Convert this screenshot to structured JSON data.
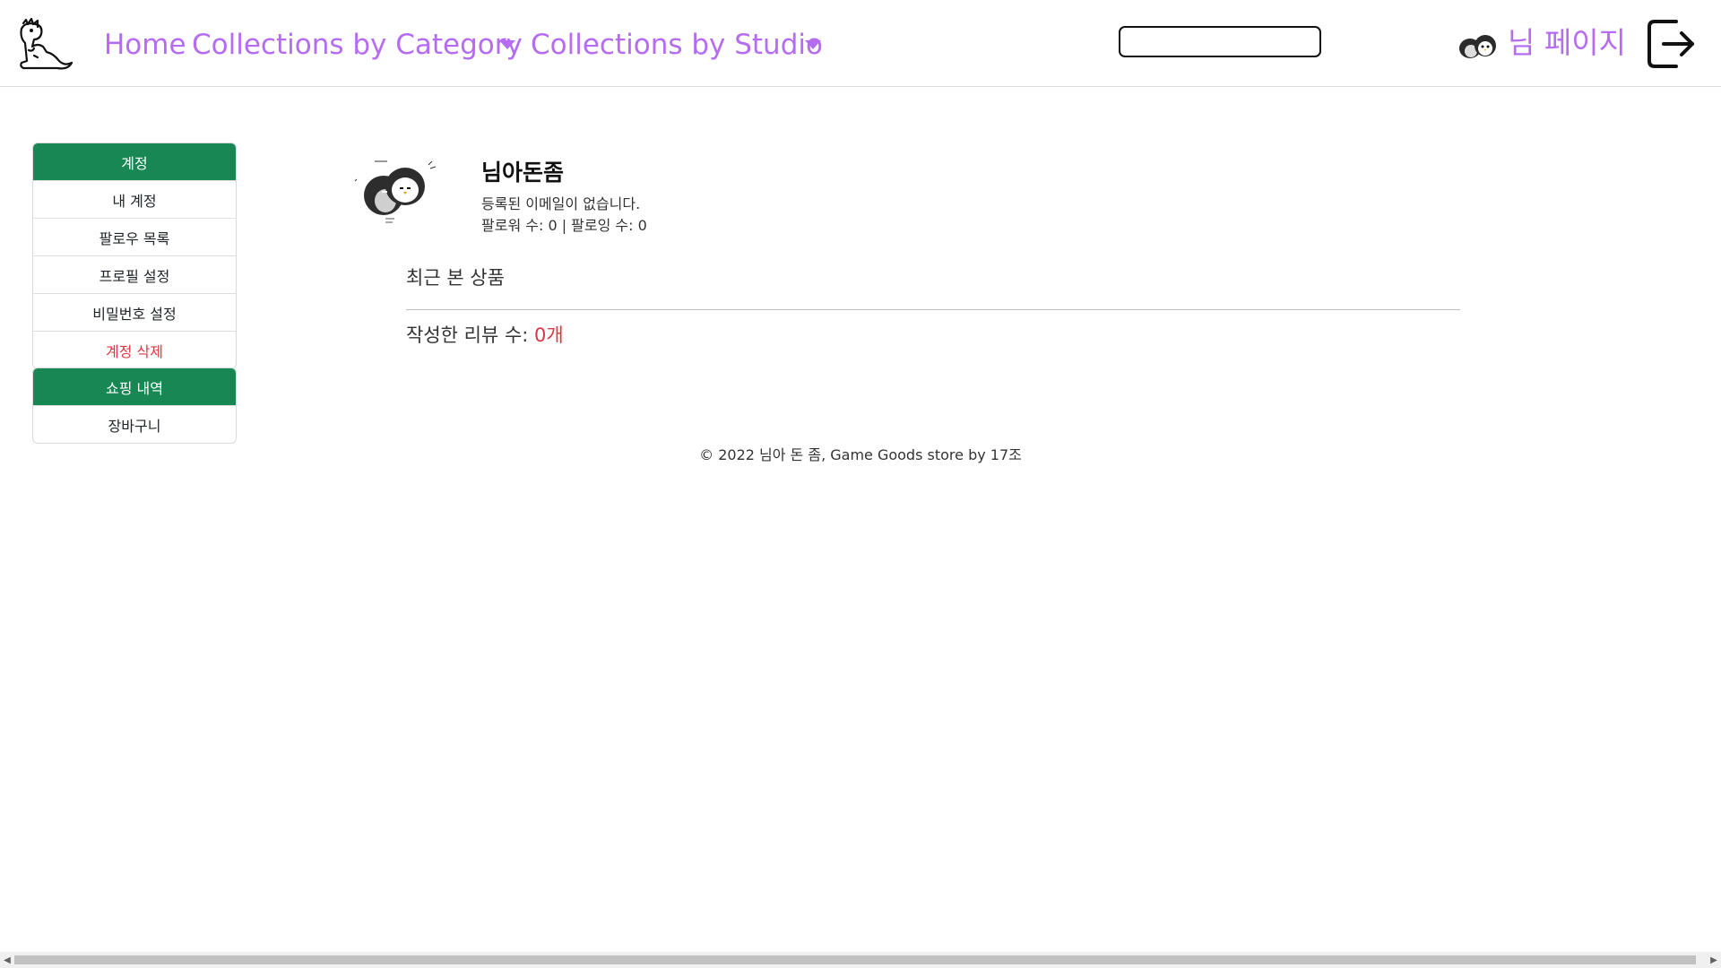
{
  "navbar": {
    "logo_icon": "dinosaur-logo-icon",
    "home_label": "Home",
    "category_label": "Collections by Category",
    "studio_label": "Collections by Studio",
    "search_value": "",
    "avatar_icon": "penguin-avatar-icon",
    "mypage_label": "님 페이지",
    "logout_icon": "logout-icon"
  },
  "sidebar": {
    "account_header": "계정",
    "account_items": [
      "내 계정",
      "팔로우 목록",
      "프로필 설정",
      "비밀번호 설정",
      "계정 삭제"
    ],
    "shopping_header": "쇼핑 내역",
    "shopping_items": [
      "장바구니"
    ]
  },
  "profile": {
    "name": "님아돈좀",
    "email": "등록된 이메일이 없습니다.",
    "follow": "팔로워 수: 0 | 팔로잉 수: 0"
  },
  "main": {
    "recent_title": "최근 본 상품",
    "review_label": "작성한 리뷰 수: ",
    "review_count": "0개"
  },
  "footer": {
    "text": "© 2022 님아 돈 좀, Game Goods store by 17조"
  },
  "colors": {
    "accent": "#b66cf2",
    "sidebar_header": "#198754",
    "danger": "#dc3545"
  }
}
